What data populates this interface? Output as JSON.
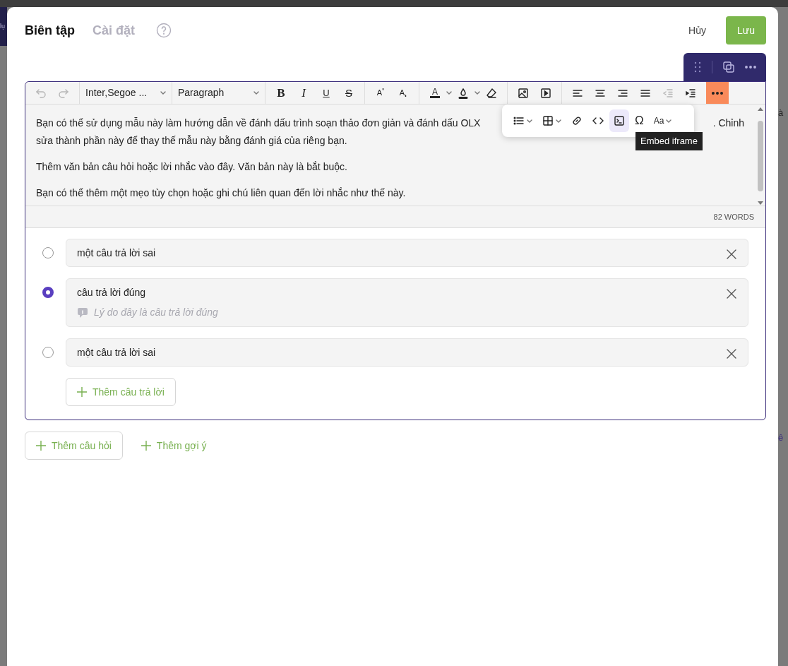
{
  "backdrop_fragments": [
    "lụ",
    "à",
    "ê"
  ],
  "tabs": [
    {
      "label": "Biên tập",
      "selected": true
    },
    {
      "label": "Cài đặt",
      "selected": false
    }
  ],
  "actions": [
    {
      "label": "Hủy",
      "kind": "text"
    },
    {
      "label": "Lưu",
      "kind": "primary"
    }
  ],
  "toolbar": {
    "undo_disabled": true,
    "redo_disabled": true,
    "font_family": "Inter,Segoe ...",
    "block_format": "Paragraph",
    "style_glyphs": [
      "B",
      "I",
      "U",
      "S"
    ],
    "script_glyphs": [
      "A",
      "A"
    ],
    "color_glyph": "A",
    "outdent_disabled": true,
    "more_active": true
  },
  "popup": {
    "items": [
      {
        "kind": "bullets",
        "dropdown": true,
        "hovered": false
      },
      {
        "kind": "table",
        "dropdown": true,
        "hovered": false
      },
      {
        "kind": "link",
        "dropdown": false,
        "hovered": false
      },
      {
        "kind": "code",
        "dropdown": false,
        "hovered": false
      },
      {
        "kind": "embed",
        "dropdown": false,
        "hovered": true
      },
      {
        "kind": "glyph",
        "glyph": "Ω",
        "dropdown": false,
        "hovered": false
      },
      {
        "kind": "glyph",
        "glyph": "Aa",
        "dropdown": true,
        "hovered": false
      }
    ],
    "tooltip": "Embed iframe"
  },
  "content": {
    "first_line_start": "Bạn có thể sử dụng mẫu này làm hướng dẫn về đánh dấu trình soạn thảo đơn giản và đánh dấu OLX",
    "first_line_end": ". Chỉnh",
    "first_paragraph_rest": "sửa thành phần này để thay thế mẫu này bằng đánh giá của riêng bạn.",
    "paragraphs": [
      "Thêm văn bản câu hỏi hoặc lời nhắc vào đây. Văn bản này là bắt buộc.",
      "Bạn có thể thêm một mẹo tùy chọn hoặc ghi chú liên quan đến lời nhắc như thế này."
    ]
  },
  "word_count": "82 WORDS",
  "answers": [
    {
      "text": "một câu trả lời sai",
      "selected": false
    },
    {
      "text": "câu trả lời đúng",
      "selected": true,
      "feedback_placeholder": "Lý do đây là câu trả lời đúng"
    },
    {
      "text": "một câu trả lời sai",
      "selected": false
    }
  ],
  "add_answer": "Thêm câu trả lời",
  "footer_buttons": [
    {
      "label": "Thêm câu hỏi",
      "kind": "outline"
    },
    {
      "label": "Thêm gợi ý",
      "kind": "link"
    }
  ]
}
